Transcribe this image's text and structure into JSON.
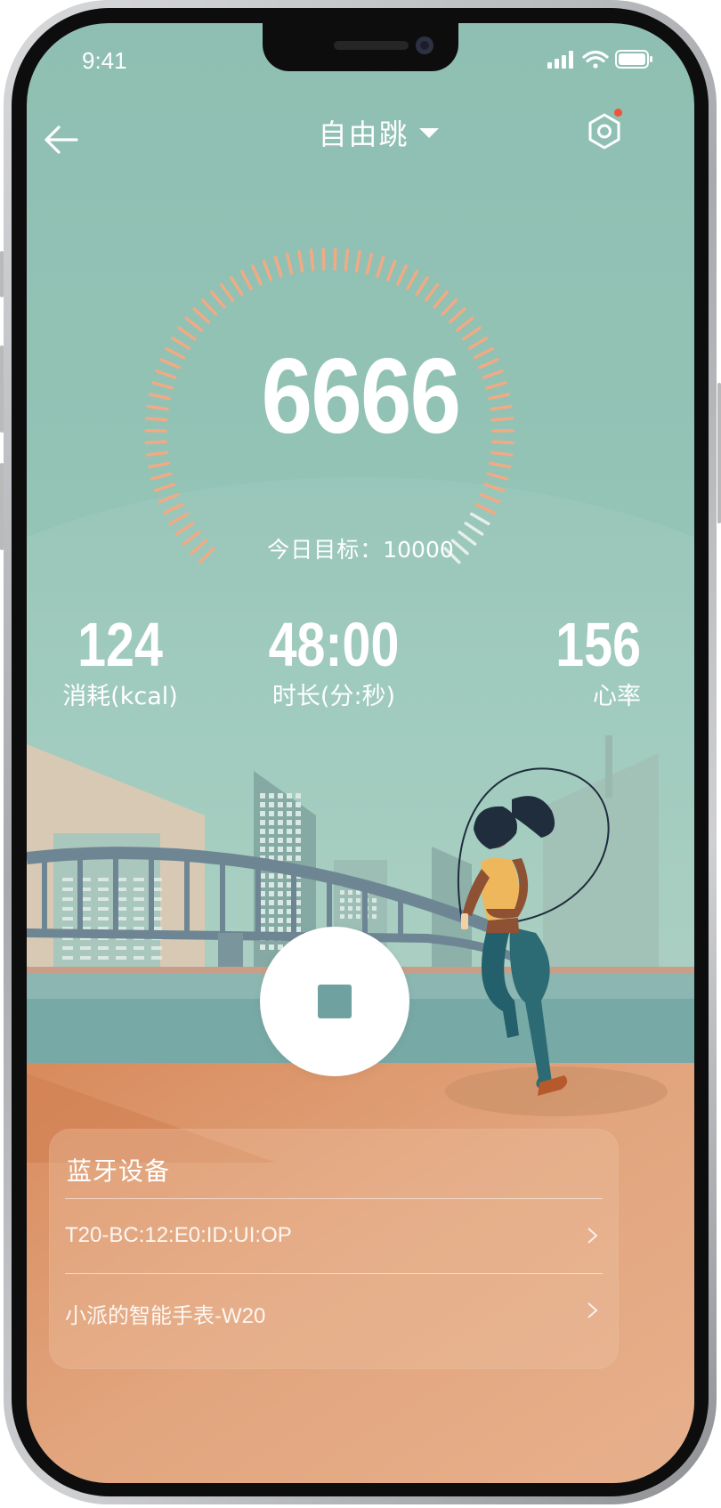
{
  "status_bar": {
    "time": "9:41"
  },
  "header": {
    "title": "自由跳"
  },
  "counter": {
    "count": "6666",
    "goal_label": "今日目标：",
    "goal_value": "10000",
    "progress": 0.6666
  },
  "stats": [
    {
      "value": "124",
      "label": "消耗(kcal)"
    },
    {
      "value": "48:00",
      "label": "时长(分:秒)"
    },
    {
      "value": "156",
      "label": "心率"
    }
  ],
  "bluetooth": {
    "title": "蓝牙设备",
    "devices": [
      {
        "name": "T20-BC:12:E0:ID:UI:OP"
      },
      {
        "name": "小派的智能手表-W20"
      }
    ]
  },
  "colors": {
    "sky": "#92c3b5",
    "gauge_active": "#f2aa84",
    "gauge_inactive": "#e6efe9",
    "notify_dot": "#f0533a",
    "stop_square": "#6ea19f",
    "ground": "#de9a72"
  },
  "icons": [
    "back-arrow-icon",
    "caret-down-icon",
    "gear-icon",
    "stop-icon",
    "chevron-right-icon",
    "signal-icon",
    "wifi-icon",
    "battery-icon"
  ]
}
